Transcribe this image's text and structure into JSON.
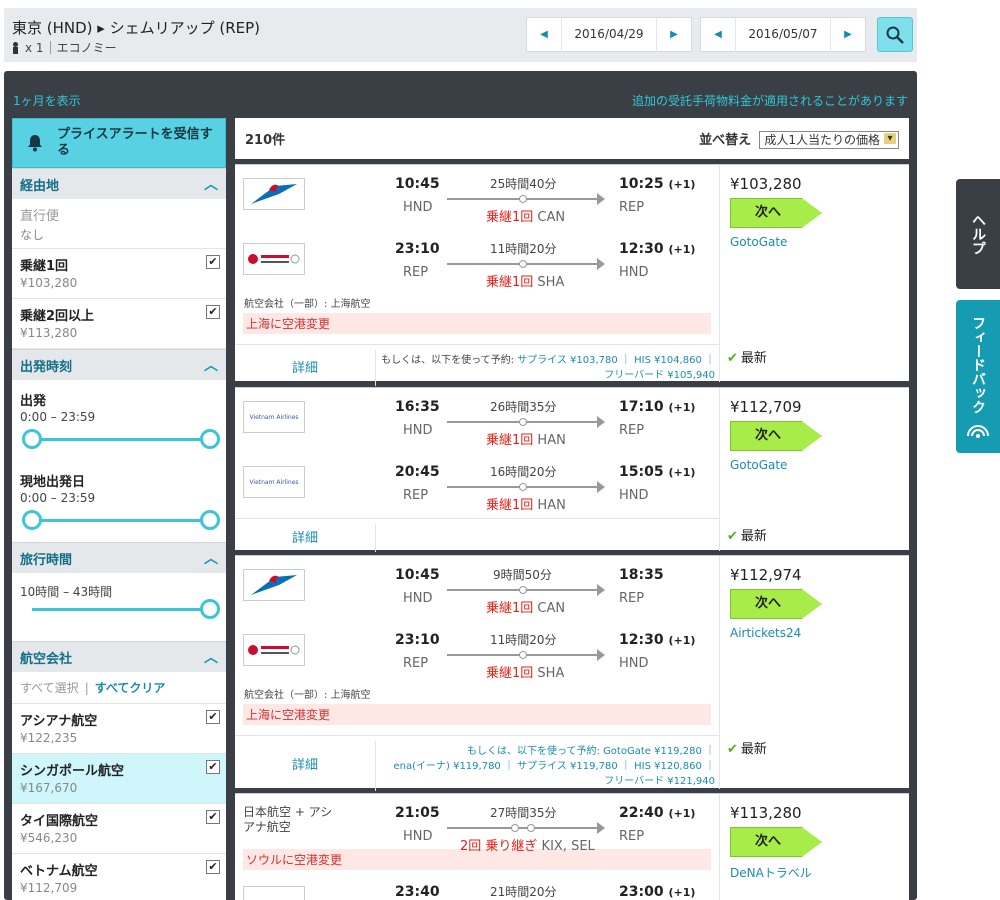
{
  "search": {
    "route": "東京 (HND) ▸ シェムリアップ (REP)",
    "passengers": "x 1",
    "cabin": "エコノミー",
    "depart_date": "2016/04/29",
    "return_date": "2016/05/07"
  },
  "links": {
    "month_view": "1ヶ月を表示",
    "baggage_notice": "追加の受託手荷物料金が適用されることがあります"
  },
  "sidebar": {
    "price_alert": "プライスアラートを受信する",
    "stops": {
      "title": "経由地",
      "items": [
        {
          "name": "直行便",
          "price": "なし"
        },
        {
          "name": "乗継1回",
          "price": "¥103,280"
        },
        {
          "name": "乗継2回以上",
          "price": "¥113,280"
        }
      ]
    },
    "departure": {
      "title": "出発時刻",
      "outbound_label": "出発",
      "outbound_range": "0:00 – 23:59",
      "return_label": "現地出発日",
      "return_range": "0:00 – 23:59"
    },
    "duration": {
      "title": "旅行時間",
      "range": "10時間 – 43時間"
    },
    "airlines": {
      "title": "航空会社",
      "select_all": "すべて選択",
      "clear_all": "すべてクリア",
      "items": [
        {
          "name": "アシアナ航空",
          "price": "¥122,235"
        },
        {
          "name": "シンガポール航空",
          "price": "¥167,670"
        },
        {
          "name": "タイ国際航空",
          "price": "¥546,230"
        },
        {
          "name": "ベトナム航空",
          "price": "¥112,709"
        }
      ]
    }
  },
  "results": {
    "count": "210件",
    "sort_label": "並べ替え",
    "sort_value": "成人1人当たりの価格",
    "details_label": "詳細",
    "newest_label": "最新",
    "next_label": "次へ",
    "cards": [
      {
        "legs": [
          {
            "dep": "10:45",
            "dep_code": "HND",
            "duration": "25時間40分",
            "stops": "乗継1回",
            "via": "CAN",
            "arr": "10:25",
            "plus": "(+1)",
            "arr_code": "REP"
          },
          {
            "dep": "23:10",
            "dep_code": "REP",
            "duration": "11時間20分",
            "stops": "乗継1回",
            "via": "SHA",
            "arr": "12:30",
            "plus": "(+1)",
            "arr_code": "HND"
          }
        ],
        "operated": "航空会社（一部）: 上海航空",
        "warning": "上海に空港変更",
        "price": "¥103,280",
        "agent": "GotoGate",
        "alt_line1": "もしくは、以下を使って予約:",
        "alt_line1_links": "サプライス ¥103,780 ｜ HIS ¥104,860 ｜",
        "alt_line2": "フリーバード ¥105,940"
      },
      {
        "legs": [
          {
            "dep": "16:35",
            "dep_code": "HND",
            "duration": "26時間35分",
            "stops": "乗継1回",
            "via": "HAN",
            "arr": "17:10",
            "plus": "(+1)",
            "arr_code": "REP"
          },
          {
            "dep": "20:45",
            "dep_code": "REP",
            "duration": "16時間20分",
            "stops": "乗継1回",
            "via": "HAN",
            "arr": "15:05",
            "plus": "(+1)",
            "arr_code": "HND"
          }
        ],
        "price": "¥112,709",
        "agent": "GotoGate"
      },
      {
        "legs": [
          {
            "dep": "10:45",
            "dep_code": "HND",
            "duration": "9時間50分",
            "stops": "乗継1回",
            "via": "CAN",
            "arr": "18:35",
            "plus": "",
            "arr_code": "REP"
          },
          {
            "dep": "23:10",
            "dep_code": "REP",
            "duration": "11時間20分",
            "stops": "乗継1回",
            "via": "SHA",
            "arr": "12:30",
            "plus": "(+1)",
            "arr_code": "HND"
          }
        ],
        "operated": "航空会社（一部）: 上海航空",
        "warning": "上海に空港変更",
        "price": "¥112,974",
        "agent": "Airtickets24",
        "alt_line1": "もしくは、以下を使って予約: GotoGate ¥119,280 ｜",
        "alt_line2": "ena(イーナ) ¥119,780 ｜ サプライス ¥119,780 ｜ HIS ¥120,860 ｜",
        "alt_line3": "フリーバード ¥121,940"
      },
      {
        "airline_text": "日本航空 + アシアナ航空",
        "legs": [
          {
            "dep": "21:05",
            "dep_code": "HND",
            "duration": "27時間35分",
            "stops": "2回 乗り継ぎ",
            "via": "KIX, SEL",
            "arr": "22:40",
            "plus": "(+1)",
            "arr_code": "REP"
          },
          {
            "dep": "23:40",
            "dep_code": "",
            "duration": "21時間20分",
            "stops": "",
            "via": "",
            "arr": "23:00",
            "plus": "(+1)",
            "arr_code": ""
          }
        ],
        "warning": "ソウルに空港変更",
        "price": "¥113,280",
        "agent": "DeNAトラベル"
      }
    ]
  },
  "side_tabs": {
    "help": "ヘルプ",
    "feedback": "フィードバック"
  },
  "colors": {
    "accent": "#30c7d6",
    "next_button": "#a8ec4a",
    "warning": "#e2231a",
    "panel": "#3a3f46"
  }
}
